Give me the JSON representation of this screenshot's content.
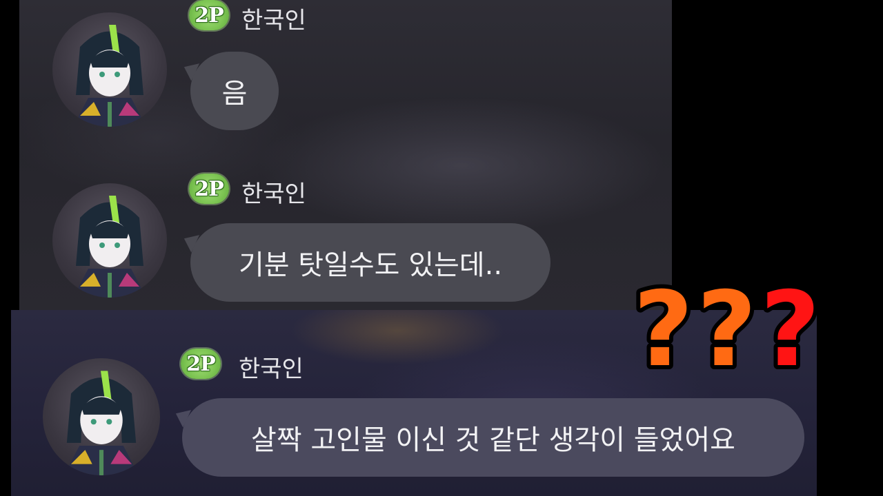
{
  "messages": [
    {
      "badge": "2P",
      "name": "한국인",
      "text": "음"
    },
    {
      "badge": "2P",
      "name": "한국인",
      "text": "기분 탓일수도 있는데.."
    },
    {
      "badge": "2P",
      "name": "한국인",
      "text": "살짝 고인물 이신 것 같단 생각이 들었어요"
    }
  ],
  "overlay": {
    "marks": "???",
    "colors": {
      "orange": "#ff6a13",
      "red": "#ff1414"
    }
  },
  "colors": {
    "bubble": "#4a4a52",
    "badge": "#7cc452",
    "background": "#000000"
  }
}
